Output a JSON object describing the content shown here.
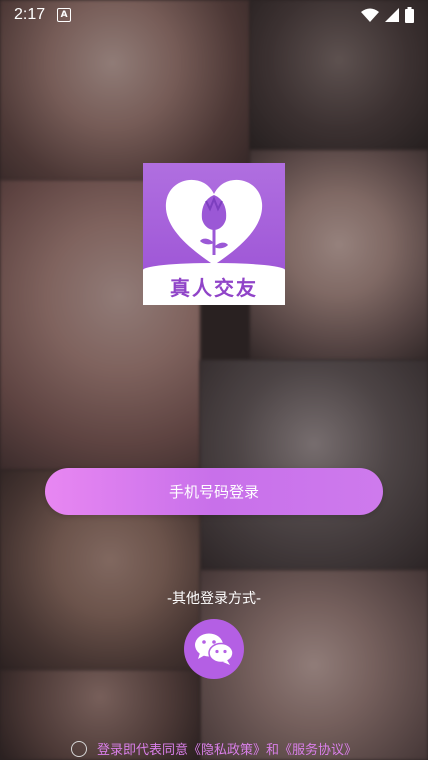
{
  "status_bar": {
    "time": "2:17",
    "notification_icon": "a-icon",
    "icons": [
      "wifi-icon",
      "signal-icon",
      "battery-icon"
    ]
  },
  "logo": {
    "text": "真人交友",
    "icon": "tulip-heart-icon"
  },
  "login": {
    "phone_button_label": "手机号码登录",
    "other_methods_label": "-其他登录方式-",
    "wechat_icon": "wechat-icon"
  },
  "agreement": {
    "prefix": "登录即代表同意",
    "privacy_link": "《隐私政策》",
    "conjunction": "和",
    "service_link": "《服务协议》"
  },
  "colors": {
    "accent": "#b45fe4",
    "button_gradient_start": "#e887f2",
    "button_gradient_end": "#ce7aed",
    "agreement_text": "#d97fe9"
  }
}
